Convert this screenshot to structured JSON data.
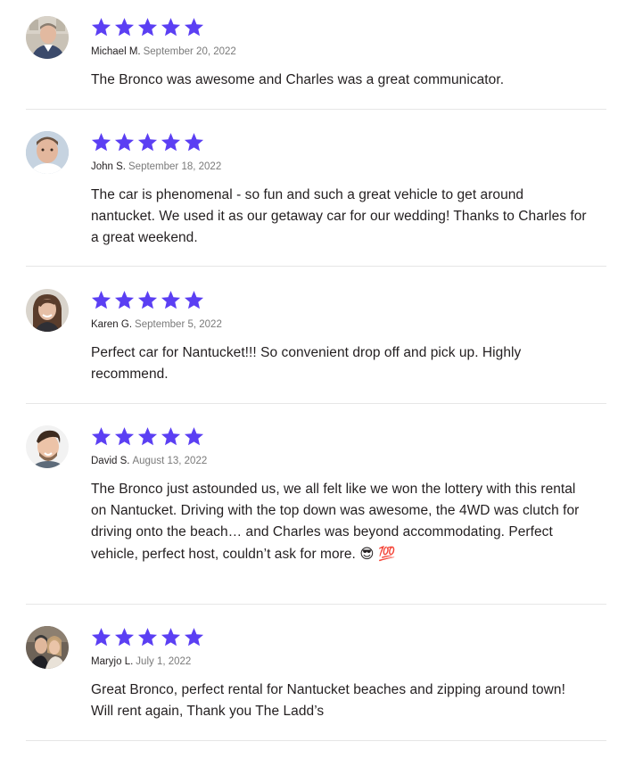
{
  "colors": {
    "star": "#5b3ff3",
    "divider": "#e6e6e6",
    "text": "#231f20",
    "date": "#7a7a7a"
  },
  "reviews": [
    {
      "rating": 5,
      "name": "Michael M.",
      "date": "September 20, 2022",
      "text": "The Bronco was awesome and Charles was a great communicator.",
      "avatar": "avatar-photo-michael"
    },
    {
      "rating": 5,
      "name": "John S.",
      "date": "September 18, 2022",
      "text": "The car is phenomenal - so fun and such a great vehicle to get around nantucket. We used it as our getaway car for our wedding! Thanks to Charles for a great weekend.",
      "avatar": "avatar-photo-john"
    },
    {
      "rating": 5,
      "name": "Karen G.",
      "date": "September 5, 2022",
      "text": "Perfect car for Nantucket!!! So convenient drop off and pick up. Highly recommend.",
      "avatar": "avatar-photo-karen"
    },
    {
      "rating": 5,
      "name": "David S.",
      "date": "August 13, 2022",
      "text": "The Bronco just astounded us, we all felt like we won the lottery with this rental on Nantucket. Driving with the top down was awesome, the 4WD was clutch for driving onto the beach… and Charles was beyond accommodating. Perfect vehicle, perfect host, couldn’t ask for more.",
      "emoji": "😎 💯",
      "avatar": "avatar-photo-david"
    },
    {
      "rating": 5,
      "name": "Maryjo L.",
      "date": "July 1, 2022",
      "text": "Great Bronco, perfect rental for Nantucket beaches and zipping around town! Will rent again, Thank you The Ladd’s",
      "avatar": "avatar-photo-maryjo"
    }
  ]
}
